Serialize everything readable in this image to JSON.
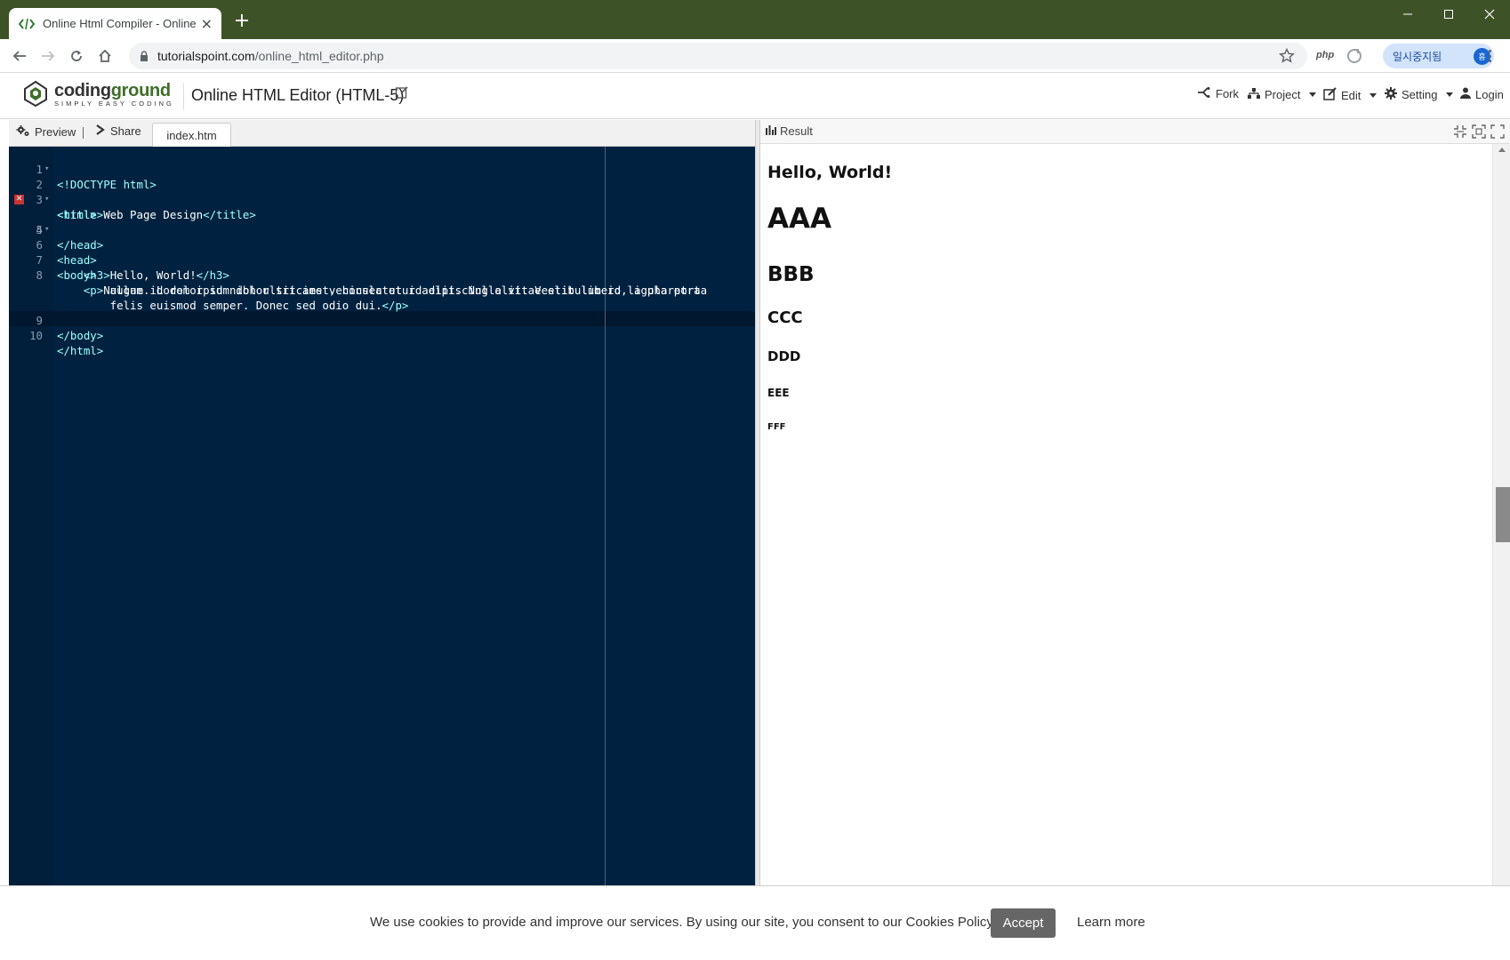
{
  "browser": {
    "tab_title": "Online Html Compiler - Online H",
    "url_domain": "tutorialspoint.com",
    "url_path": "/online_html_editor.php",
    "extension_php": "php",
    "profile_status": "일시중지됨",
    "profile_initial": "흥"
  },
  "header": {
    "logo_name_1": "coding",
    "logo_name_2": "ground",
    "logo_tagline": "SIMPLY EASY CODING",
    "title": "Online HTML Editor (HTML-5)",
    "menu": {
      "fork": "Fork",
      "project": "Project",
      "edit": "Edit",
      "setting": "Setting",
      "login": "Login"
    }
  },
  "editor": {
    "preview_label": "Preview",
    "share_label": "Share",
    "file_tab": "index.htm",
    "lines": [
      {
        "num": "1",
        "text": "<!DOCTYPE html>"
      },
      {
        "num": "2",
        "text": "<html>"
      },
      {
        "num": "3",
        "text": "<title>Web Page Design</title>"
      },
      {
        "num": "4",
        "text": "<head>"
      },
      {
        "num": "5",
        "text": "</head>"
      },
      {
        "num": "6",
        "text": "<body>"
      },
      {
        "num": "7",
        "text": "    <h3>Hello, World!</h3>"
      },
      {
        "num": "8",
        "text": "    <p>Nullam id dolor id nibh ultricies vehicula ut id elit. Nulla vitae elit libero, a pharetra"
      },
      {
        "num": "",
        "text": "        augue. Lorem ipsum dolor sit amet, consectetur adipiscing elit. Vestibulum id ligula porta"
      },
      {
        "num": "",
        "text": "        felis euismod semper. Donec sed odio dui.</p>"
      },
      {
        "num": "9",
        "text": "</body>"
      },
      {
        "num": "10",
        "text": "</html>"
      }
    ]
  },
  "result": {
    "label": "Result",
    "items": [
      "Hello, World!",
      "AAA",
      "BBB",
      "CCC",
      "DDD",
      "EEE",
      "FFF"
    ]
  },
  "cookie": {
    "text": "We use cookies to provide and improve our services. By using our site, you consent to our Cookies Policy.",
    "accept": "Accept",
    "learn_more": "Learn more"
  },
  "colors": {
    "titlebar": "#3e5228",
    "editor_bg": "#002240",
    "tag_color": "#9effff",
    "accept_btn": "#666666"
  }
}
